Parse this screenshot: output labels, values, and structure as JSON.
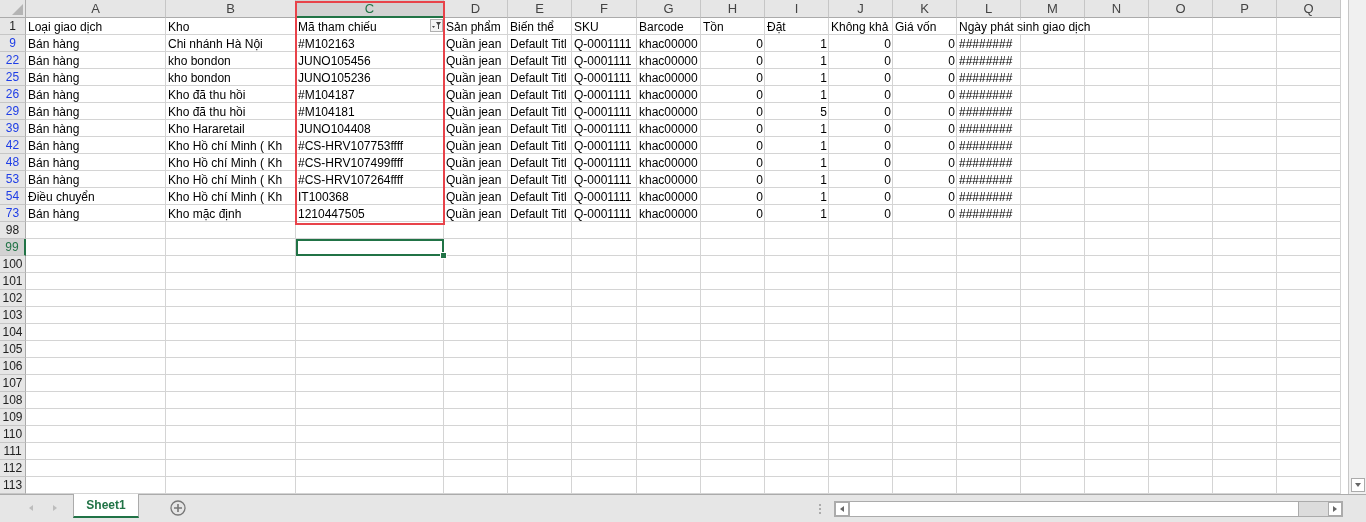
{
  "columns": [
    {
      "letter": "A",
      "kind": "text",
      "selected": false,
      "filtered": false,
      "marked": false
    },
    {
      "letter": "B",
      "kind": "text",
      "selected": false,
      "filtered": false,
      "marked": false
    },
    {
      "letter": "C",
      "kind": "text",
      "selected": true,
      "filtered": true,
      "marked": true
    },
    {
      "letter": "D",
      "kind": "text",
      "selected": false,
      "filtered": false,
      "marked": false
    },
    {
      "letter": "E",
      "kind": "text",
      "selected": false,
      "filtered": false,
      "marked": false
    },
    {
      "letter": "F",
      "kind": "text",
      "selected": false,
      "filtered": false,
      "marked": false
    },
    {
      "letter": "G",
      "kind": "text",
      "selected": false,
      "filtered": false,
      "marked": false
    },
    {
      "letter": "H",
      "kind": "number",
      "selected": false,
      "filtered": false,
      "marked": false
    },
    {
      "letter": "I",
      "kind": "number",
      "selected": false,
      "filtered": false,
      "marked": false
    },
    {
      "letter": "J",
      "kind": "number",
      "selected": false,
      "filtered": false,
      "marked": false
    },
    {
      "letter": "K",
      "kind": "number",
      "selected": false,
      "filtered": false,
      "marked": false
    },
    {
      "letter": "L",
      "kind": "text",
      "selected": false,
      "filtered": false,
      "marked": false
    },
    {
      "letter": "M",
      "kind": "text",
      "selected": false,
      "filtered": false,
      "marked": false
    },
    {
      "letter": "N",
      "kind": "text",
      "selected": false,
      "filtered": false,
      "marked": false
    },
    {
      "letter": "O",
      "kind": "text",
      "selected": false,
      "filtered": false,
      "marked": false
    },
    {
      "letter": "P",
      "kind": "text",
      "selected": false,
      "filtered": false,
      "marked": false
    },
    {
      "letter": "Q",
      "kind": "text",
      "selected": false,
      "filtered": false,
      "marked": false
    }
  ],
  "rows": [
    {
      "number": "1",
      "kind": "header",
      "filtered": false,
      "selected": false,
      "cells": [
        "Loại giao dịch",
        "Kho",
        "Mã tham chiếu",
        "Sản phẩm",
        "Biến thể",
        "SKU",
        "Barcode",
        "Tồn",
        "Đặt",
        "Không khả",
        "Giá vốn",
        "Ngày phát sinh giao dịch"
      ]
    },
    {
      "number": "9",
      "kind": "data",
      "filtered": true,
      "selected": false,
      "cells": [
        "Bán hàng",
        "Chi nhánh Hà Nội",
        "#M102163",
        "Quần jean",
        "Default Titl",
        "Q-0001111",
        "khac00000",
        "0",
        "1",
        "0",
        "0",
        "########"
      ]
    },
    {
      "number": "22",
      "kind": "data",
      "filtered": true,
      "selected": false,
      "cells": [
        "Bán hàng",
        "kho bondon",
        "JUNO105456",
        "Quần jean",
        "Default Titl",
        "Q-0001111",
        "khac00000",
        "0",
        "1",
        "0",
        "0",
        "########"
      ]
    },
    {
      "number": "25",
      "kind": "data",
      "filtered": true,
      "selected": false,
      "cells": [
        "Bán hàng",
        "kho bondon",
        "JUNO105236",
        "Quần jean",
        "Default Titl",
        "Q-0001111",
        "khac00000",
        "0",
        "1",
        "0",
        "0",
        "########"
      ]
    },
    {
      "number": "26",
      "kind": "data",
      "filtered": true,
      "selected": false,
      "cells": [
        "Bán hàng",
        "Kho đã thu hồi",
        "#M104187",
        "Quần jean",
        "Default Titl",
        "Q-0001111",
        "khac00000",
        "0",
        "1",
        "0",
        "0",
        "########"
      ]
    },
    {
      "number": "29",
      "kind": "data",
      "filtered": true,
      "selected": false,
      "cells": [
        "Bán hàng",
        "Kho đã thu hồi",
        "#M104181",
        "Quần jean",
        "Default Titl",
        "Q-0001111",
        "khac00000",
        "0",
        "5",
        "0",
        "0",
        "########"
      ]
    },
    {
      "number": "39",
      "kind": "data",
      "filtered": true,
      "selected": false,
      "cells": [
        "Bán hàng",
        "Kho Hararetail",
        "JUNO104408",
        "Quần jean",
        "Default Titl",
        "Q-0001111",
        "khac00000",
        "0",
        "1",
        "0",
        "0",
        "########"
      ]
    },
    {
      "number": "42",
      "kind": "data",
      "filtered": true,
      "selected": false,
      "cells": [
        "Bán hàng",
        "Kho Hồ chí Minh ( Kh",
        "#CS-HRV107753ffff",
        "Quần jean",
        "Default Titl",
        "Q-0001111",
        "khac00000",
        "0",
        "1",
        "0",
        "0",
        "########"
      ]
    },
    {
      "number": "48",
      "kind": "data",
      "filtered": true,
      "selected": false,
      "cells": [
        "Bán hàng",
        "Kho Hồ chí Minh ( Kh",
        "#CS-HRV107499ffff",
        "Quần jean",
        "Default Titl",
        "Q-0001111",
        "khac00000",
        "0",
        "1",
        "0",
        "0",
        "########"
      ]
    },
    {
      "number": "53",
      "kind": "data",
      "filtered": true,
      "selected": false,
      "cells": [
        "Bán hàng",
        "Kho Hồ chí Minh ( Kh",
        "#CS-HRV107264ffff",
        "Quần jean",
        "Default Titl",
        "Q-0001111",
        "khac00000",
        "0",
        "1",
        "0",
        "0",
        "########"
      ]
    },
    {
      "number": "54",
      "kind": "data",
      "filtered": true,
      "selected": false,
      "cells": [
        "Điều chuyển",
        "Kho Hồ chí Minh ( Kh",
        "IT100368",
        "Quần jean",
        "Default Titl",
        "Q-0001111",
        "khac00000",
        "0",
        "1",
        "0",
        "0",
        "########"
      ]
    },
    {
      "number": "73",
      "kind": "data",
      "filtered": true,
      "selected": false,
      "cells": [
        "Bán hàng",
        "Kho mặc định",
        "1210447505",
        "Quần jean",
        "Default Titl",
        "Q-0001111",
        "khac00000",
        "0",
        "1",
        "0",
        "0",
        "########"
      ]
    },
    {
      "number": "98",
      "kind": "data",
      "filtered": false,
      "selected": false
    },
    {
      "number": "99",
      "kind": "data",
      "filtered": false,
      "selected": true
    },
    {
      "number": "100",
      "kind": "data",
      "filtered": false,
      "selected": false
    },
    {
      "number": "101",
      "kind": "data",
      "filtered": false,
      "selected": false
    },
    {
      "number": "102",
      "kind": "data",
      "filtered": false,
      "selected": false
    },
    {
      "number": "103",
      "kind": "data",
      "filtered": false,
      "selected": false
    },
    {
      "number": "104",
      "kind": "data",
      "filtered": false,
      "selected": false
    },
    {
      "number": "105",
      "kind": "data",
      "filtered": false,
      "selected": false
    },
    {
      "number": "106",
      "kind": "data",
      "filtered": false,
      "selected": false
    },
    {
      "number": "107",
      "kind": "data",
      "filtered": false,
      "selected": false
    },
    {
      "number": "108",
      "kind": "data",
      "filtered": false,
      "selected": false
    },
    {
      "number": "109",
      "kind": "data",
      "filtered": false,
      "selected": false
    },
    {
      "number": "110",
      "kind": "data",
      "filtered": false,
      "selected": false
    },
    {
      "number": "111",
      "kind": "data",
      "filtered": false,
      "selected": false
    },
    {
      "number": "112",
      "kind": "data",
      "filtered": false,
      "selected": false
    },
    {
      "number": "113",
      "kind": "data",
      "filtered": false,
      "selected": false
    }
  ],
  "sheets": [
    {
      "name": "Sheet1",
      "selected": true
    }
  ]
}
